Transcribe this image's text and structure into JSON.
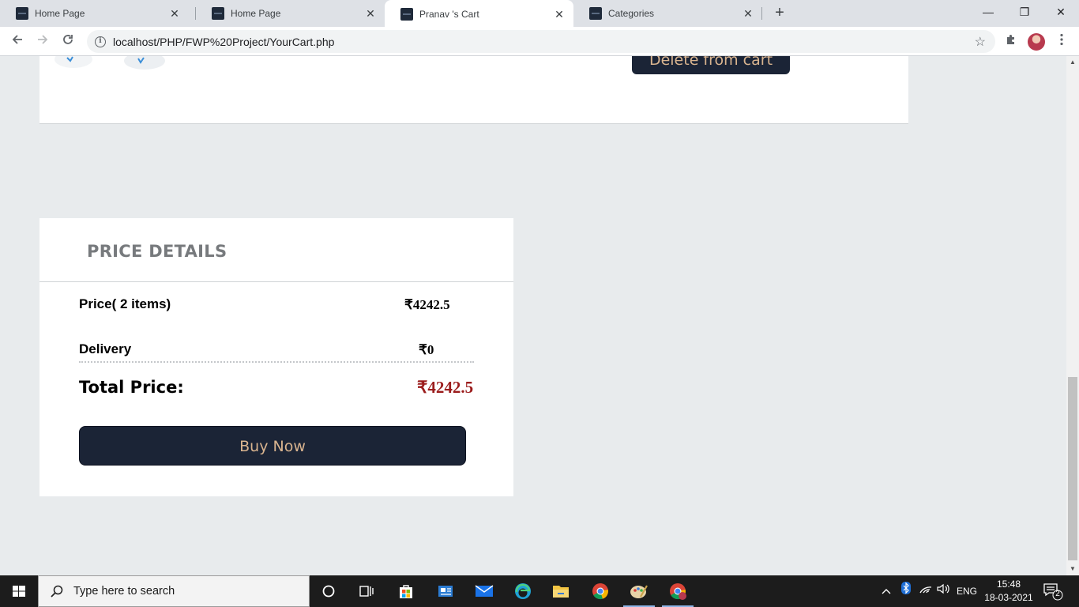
{
  "browser": {
    "tabs": [
      {
        "title": "Home Page",
        "active": false
      },
      {
        "title": "Home Page",
        "active": false
      },
      {
        "title": "Pranav 's Cart",
        "active": true
      },
      {
        "title": "Categories",
        "active": false
      }
    ],
    "tab_close_glyph": "✕",
    "new_tab_glyph": "+",
    "window_controls": {
      "minimize": "—",
      "restore": "❐",
      "close": "✕"
    },
    "url": "localhost/PHP/FWP%20Project/YourCart.php"
  },
  "cart": {
    "delete_button_label": "Delete from cart"
  },
  "price_details": {
    "title": "PRICE DETAILS",
    "price_label": "Price( 2 items)",
    "price_value": "₹4242.5",
    "delivery_label": "Delivery",
    "delivery_value": "₹0",
    "total_label": "Total Price:",
    "total_value": "₹4242.5",
    "buy_button_label": "Buy Now"
  },
  "taskbar": {
    "search_placeholder": "Type here to search",
    "language": "ENG",
    "time": "15:48",
    "date": "18-03-2021",
    "notification_count": "2"
  },
  "colors": {
    "page_background": "#e8ebed",
    "button_background": "#1b2436",
    "button_text": "#d9b48f",
    "total_price": "#9b1c1c"
  }
}
